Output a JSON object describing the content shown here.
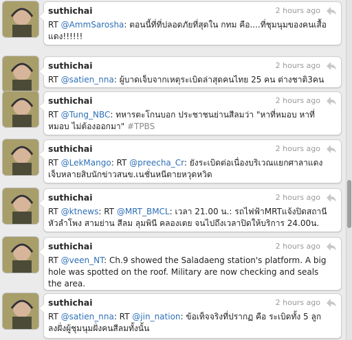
{
  "tweets": [
    {
      "user": "suthichai",
      "time": "2 hours ago",
      "rt": "RT",
      "mention1": "@AmmSarosha",
      "sep1": ":",
      "text1": " ตอนนี้ที่ที่ปลอดภัยที่สุดใน กทม คือ....ที่ชุมนุมของคนเสื้อแดง!!!!!!"
    },
    {
      "user": "suthichai",
      "time": "2 hours ago",
      "rt": "RT",
      "mention1": "@satien_nna",
      "sep1": ":",
      "text1": " ผู้บาดเจ็บจากเหตุระเบิดล่าสุดคนไทย 25 คน ต่างชาติ3คน"
    },
    {
      "user": "suthichai",
      "time": "2 hours ago",
      "rt": "RT",
      "mention1": "@Tung_NBC",
      "sep1": ":",
      "text1": " ทหารตะโกนบอก ประชาชนย่านสีลมว่า \"หาที่หมอบ หาที่หมอบ ไม่ต้องออกมา\" ",
      "hashtag": "#TPBS"
    },
    {
      "user": "suthichai",
      "time": "2 hours ago",
      "rt": "RT",
      "mention1": "@LekMango",
      "sep1": ": RT ",
      "mention2": "@preecha_Cr",
      "sep2": ":",
      "text1": " ยังระเบิดต่อเนื่องบริเวณแยกศาลาแดงเจ็บหลายสิบนักข่าวสนข.เนชั่นหนีตายหวุดหวิด"
    },
    {
      "user": "suthichai",
      "time": "2 hours ago",
      "rt": "RT",
      "mention1": "@ktnews",
      "sep1": ": RT ",
      "mention2": "@MRT_BMCL",
      "sep2": ":",
      "text1": " เวลา 21.00 น.: รถไฟฟ้าMRTแจ้งปิดสถานีหัวลำโพง สามย่าน สีลม ลุมพินี คลองเตย จนไปถึงเวลาปิดให้บริการ 24.00น."
    },
    {
      "user": "suthichai",
      "time": "2 hours ago",
      "rt": "RT",
      "mention1": "@veen_NT",
      "sep1": ":",
      "text1": " Ch.9 showed the Saladaeng station's platform. A big hole was spotted on the roof. Military are now checking and seals the area."
    },
    {
      "user": "suthichai",
      "time": "2 hours ago",
      "rt": "RT",
      "mention1": "@satien_nna",
      "sep1": ": RT ",
      "mention2": "@jin_nation",
      "sep2": ":",
      "text1": " ข้อเท็จจริงที่ปรากฏ คือ ระเบิดทั้ง 5 ลูก ลงฝั่งผู้ชุมนุมฝั่งคนสีลมทั้งนั้น"
    }
  ],
  "colors": {
    "mention": "#2d6fb7",
    "hashtag": "#8a8a8a",
    "username": "#262626",
    "timestamp": "#9a9a9a"
  },
  "icons": {
    "reply": "reply-arrow-icon",
    "avatar": "avatar"
  }
}
